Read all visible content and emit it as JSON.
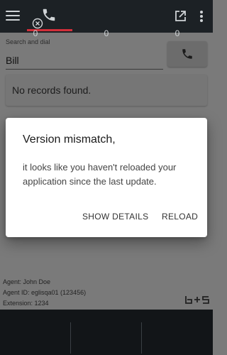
{
  "topbar": {
    "menu_icon": "hamburger-menu-icon",
    "tab_icon": "phone-icon",
    "status_icon": "circle-x-icon",
    "popout_icon": "open-in-new-icon",
    "more_icon": "more-vertical-icon",
    "accent_color": "#d32f3a"
  },
  "dialer": {
    "search_label": "Search and dial",
    "search_value": "Bill",
    "dial_icon": "phone-icon",
    "no_records": "No records found."
  },
  "agent": {
    "name_line": "Agent: John Doe",
    "id_line": "Agent ID: eglisqa01 (123456)",
    "extension_line": "Extension: 1234",
    "logo_text": "b+s"
  },
  "counters": [
    "0",
    "0",
    "0"
  ],
  "dialog": {
    "title": "Version mismatch,",
    "body": "it looks like you haven't reloaded your application since the last update.",
    "show_details": "SHOW DETAILS",
    "reload": "RELOAD"
  }
}
